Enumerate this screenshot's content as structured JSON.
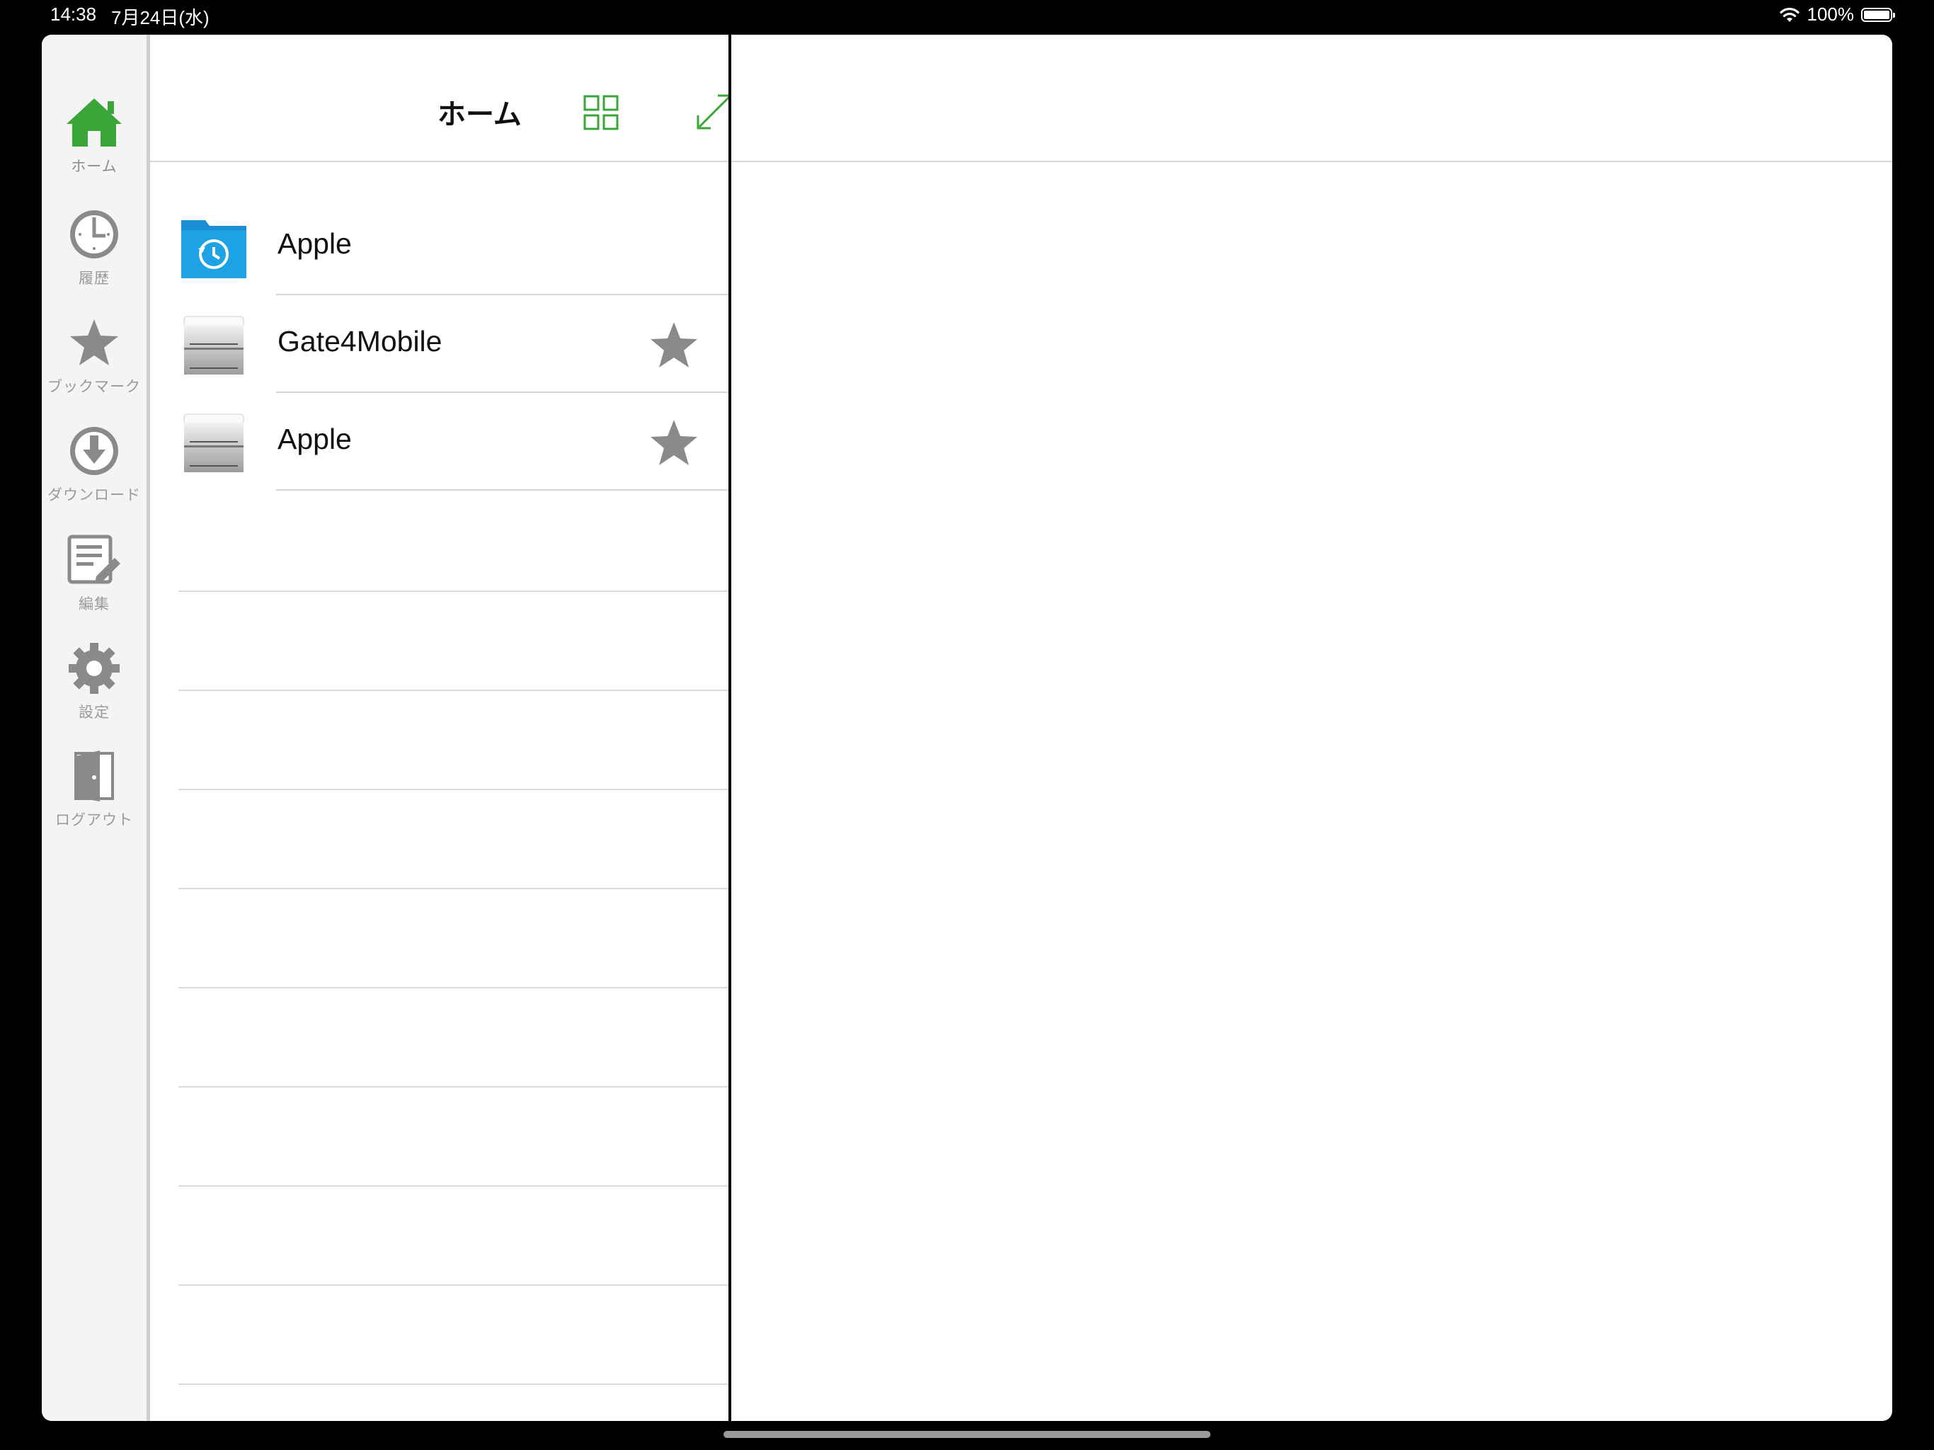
{
  "status_bar": {
    "time": "14:38",
    "date": "7月24日(水)",
    "battery": "100%"
  },
  "sidebar": {
    "items": [
      {
        "label": "ホーム",
        "icon": "home-icon",
        "active": true
      },
      {
        "label": "履歴",
        "icon": "clock-icon"
      },
      {
        "label": "ブックマーク",
        "icon": "star-icon"
      },
      {
        "label": "ダウンロード",
        "icon": "download-icon"
      },
      {
        "label": "編集",
        "icon": "edit-icon"
      },
      {
        "label": "設定",
        "icon": "gear-icon"
      },
      {
        "label": "ログアウト",
        "icon": "logout-door-icon"
      }
    ]
  },
  "header": {
    "title": "ホーム"
  },
  "list": {
    "items": [
      {
        "label": "Apple",
        "icon": "history-folder-icon",
        "starred": false
      },
      {
        "label": "Gate4Mobile",
        "icon": "server-icon",
        "starred": true
      },
      {
        "label": "Apple",
        "icon": "server-icon",
        "starred": true
      }
    ]
  },
  "colors": {
    "accent": "#3aa63a",
    "inactive_icon": "#8a8a8a",
    "folder": "#1a8fd6"
  }
}
